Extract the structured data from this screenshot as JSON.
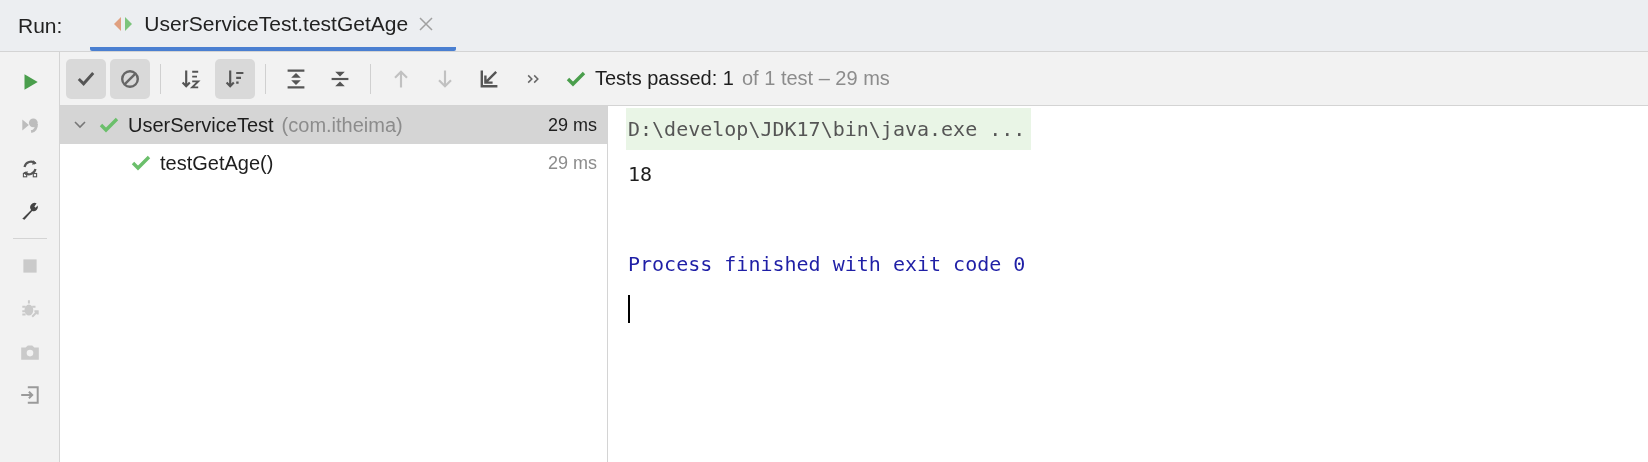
{
  "tool_window": {
    "label": "Run:",
    "tabs": [
      {
        "title": "UserServiceTest.testGetAge",
        "selected": true,
        "closable": true
      }
    ]
  },
  "gutter": [
    {
      "kind": "run",
      "disabled": false
    },
    {
      "kind": "rerun-failed",
      "disabled": true
    },
    {
      "kind": "auto-test",
      "disabled": false
    },
    {
      "kind": "settings",
      "disabled": false
    },
    {
      "kind": "separator"
    },
    {
      "kind": "stop",
      "disabled": true
    },
    {
      "kind": "debug",
      "disabled": true
    },
    {
      "kind": "camera",
      "disabled": true
    },
    {
      "kind": "exit",
      "disabled": false
    }
  ],
  "toolbar": [
    {
      "kind": "show-passed",
      "pressed": true,
      "disabled": false
    },
    {
      "kind": "show-ignored",
      "pressed": true,
      "disabled": false
    },
    {
      "kind": "separator"
    },
    {
      "kind": "sort-alpha",
      "pressed": false,
      "disabled": false
    },
    {
      "kind": "sort-duration",
      "pressed": true,
      "disabled": false
    },
    {
      "kind": "separator"
    },
    {
      "kind": "expand-all",
      "pressed": false,
      "disabled": false
    },
    {
      "kind": "collapse-all",
      "pressed": false,
      "disabled": false
    },
    {
      "kind": "separator"
    },
    {
      "kind": "prev",
      "pressed": false,
      "disabled": true
    },
    {
      "kind": "next",
      "pressed": false,
      "disabled": true
    },
    {
      "kind": "import",
      "pressed": false,
      "disabled": false
    },
    {
      "kind": "more",
      "pressed": false,
      "disabled": false
    }
  ],
  "status": {
    "passed": "Tests passed: 1",
    "detail": "of 1 test – 29 ms"
  },
  "tree": [
    {
      "name": "UserServiceTest",
      "package": "(com.itheima)",
      "time": "29 ms",
      "passed": true,
      "expanded": true,
      "selected": true,
      "children": [
        {
          "name": "testGetAge()",
          "time": "29 ms",
          "passed": true,
          "selected": false
        }
      ]
    }
  ],
  "console": [
    {
      "kind": "command",
      "text": "D:\\develop\\JDK17\\bin\\java.exe ..."
    },
    {
      "kind": "output",
      "text": "18"
    },
    {
      "kind": "blank"
    },
    {
      "kind": "system",
      "text": "Process finished with exit code 0"
    },
    {
      "kind": "cursor"
    }
  ]
}
